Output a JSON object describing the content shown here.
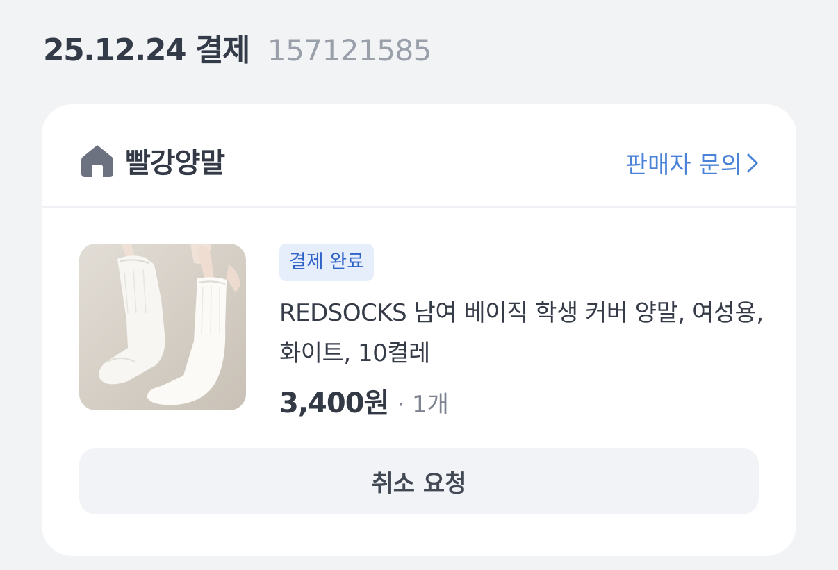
{
  "order": {
    "date_label": "25.12.24 결제",
    "order_number": "157121585"
  },
  "seller": {
    "icon": "store-icon",
    "name": "빨강양말",
    "inquiry_label": "판매자 문의",
    "inquiry_icon": "chevron-right-icon"
  },
  "item": {
    "thumbnail": "white-socks-photo",
    "status": "결제 완료",
    "name": "REDSOCKS 남여 베이직 학생 커버 양말, 여성용, 화이트, 10켤레",
    "price": "3,400원",
    "quantity": "· 1개"
  },
  "actions": {
    "cancel_label": "취소 요청"
  },
  "colors": {
    "background": "#f2f3f5",
    "card": "#ffffff",
    "accent": "#4a82d8",
    "badge_bg": "#e6edfb",
    "badge_text": "#2f63c8"
  }
}
